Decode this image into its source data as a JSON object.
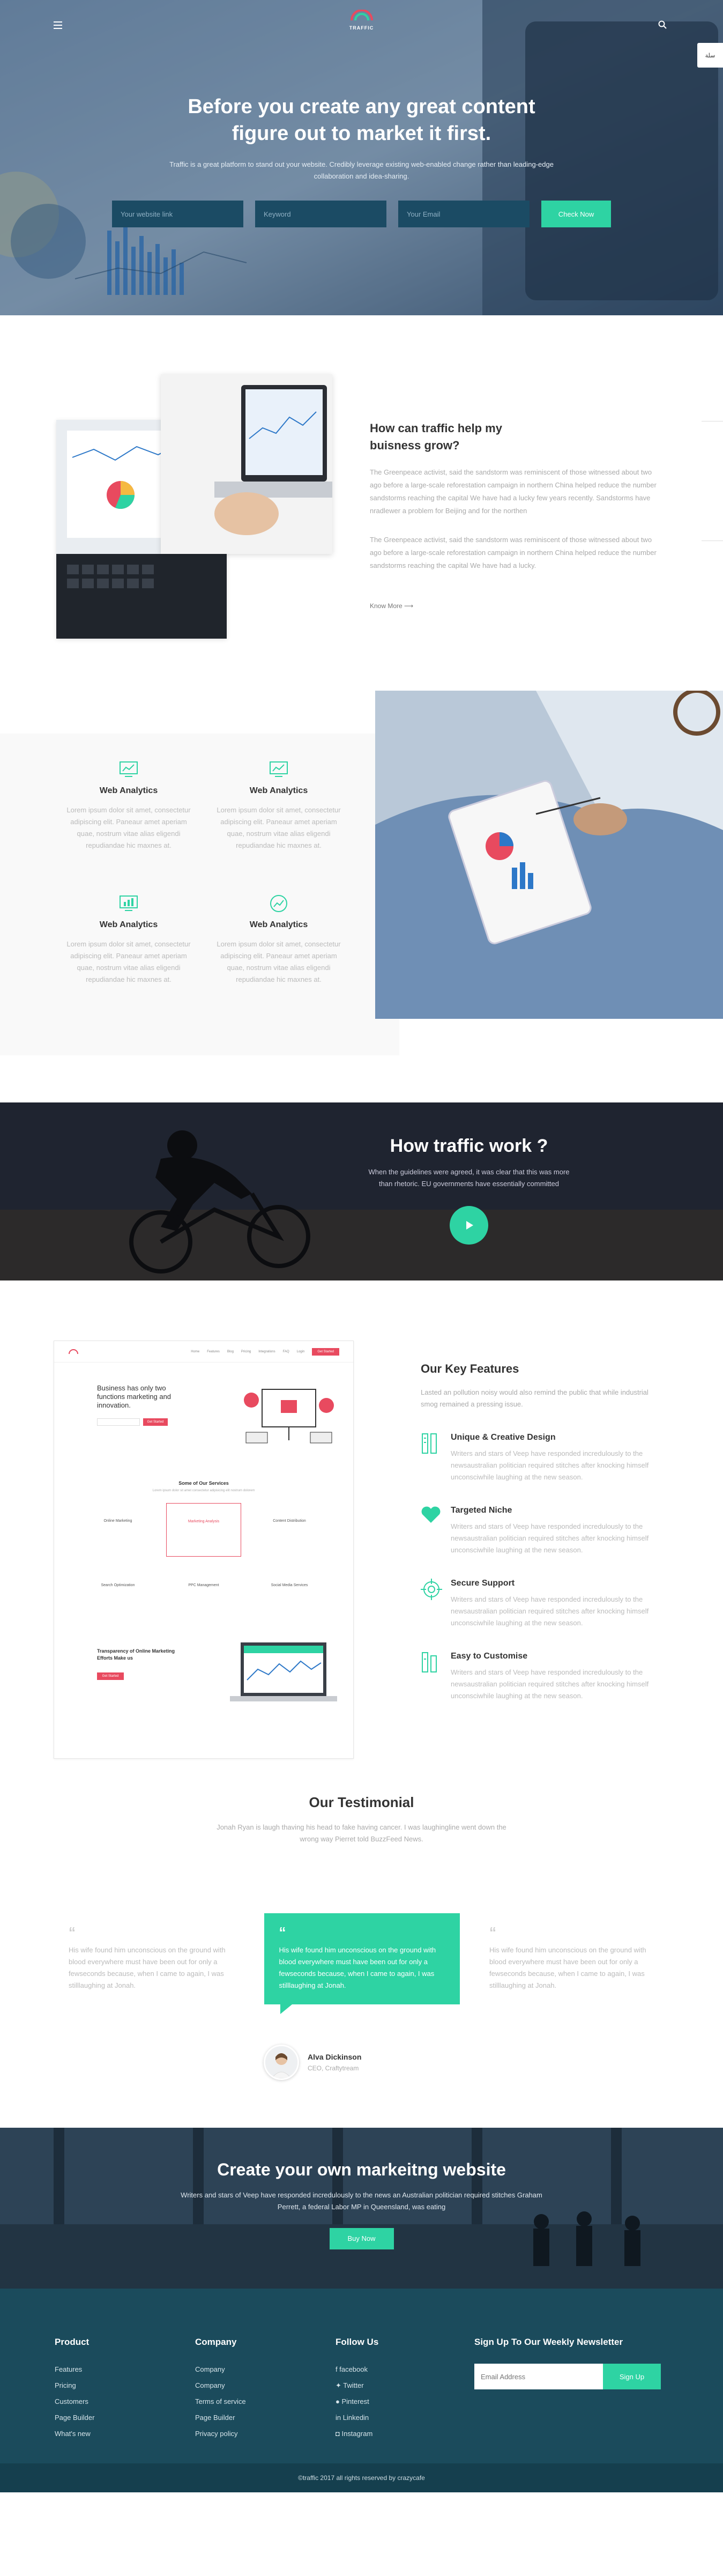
{
  "brand": {
    "logo_text": "TRAFFIC",
    "side_tab": "سلة"
  },
  "hero": {
    "title": "Before you create any great content figure out to market it first.",
    "subtitle": "Traffic is a great platform to stand out your website. Credibly leverage existing web-enabled change rather than leading-edge collaboration and idea-sharing.",
    "inputs": [
      {
        "placeholder": "Your website link"
      },
      {
        "placeholder": "Keyword"
      },
      {
        "placeholder": "Your Email"
      }
    ],
    "button": "Check Now"
  },
  "about": {
    "title": "How can traffic help my buisness grow?",
    "para1": "The Greenpeace activist, said the sandstorm was reminiscent of those witnessed about two ago before a large-scale reforestation campaign in northern China helped reduce the number sandstorms reaching the capital We have had a lucky few years recently. Sandstorms have nradlewer a problem for Beijing and for the northen",
    "para2": "The Greenpeace activist, said the sandstorm was reminiscent of those witnessed about two ago before a large-scale reforestation campaign in northern China helped reduce the number sandstorms reaching the capital We have had a lucky.",
    "link": "Know More ⟶"
  },
  "features": {
    "items": [
      {
        "title": "Web Analytics",
        "desc": "Lorem ipsum dolor sit amet, consectetur adipiscing elit. Paneaur amet aperiam quae, nostrum vitae alias eligendi repudiandae hic maxnes at."
      },
      {
        "title": "Web Analytics",
        "desc": "Lorem ipsum dolor sit amet, consectetur adipiscing elit. Paneaur amet aperiam quae, nostrum vitae alias eligendi repudiandae hic maxnes at."
      },
      {
        "title": "Web Analytics",
        "desc": "Lorem ipsum dolor sit amet, consectetur adipiscing elit. Paneaur amet aperiam quae, nostrum vitae alias eligendi repudiandae hic maxnes at."
      },
      {
        "title": "Web Analytics",
        "desc": "Lorem ipsum dolor sit amet, consectetur adipiscing elit. Paneaur amet aperiam quae, nostrum vitae alias eligendi repudiandae hic maxnes at."
      }
    ]
  },
  "how": {
    "title": "How traffic work ?",
    "text": "When the guidelines were agreed, it was clear that this was more than rhetoric. EU governments have essentially committed"
  },
  "mockup": {
    "nav": [
      "Home",
      "Features",
      "Blog",
      "Pricing",
      "Integrations",
      "FAQ",
      "Login"
    ],
    "nav_cta": "Get Started",
    "hero_title": "Business has only two functions marketing and innovation.",
    "hero_btn": "Get Started",
    "services_title": "Some of Our Services",
    "services_sub": "Lorem ipsum dolor sit amet consectetur adipisicing elit nostrum dolorem",
    "services": [
      "Online Marketing",
      "Marketing Analysis",
      "Content Distribution",
      "Search Optimization",
      "PPC Management",
      "Social Media Services"
    ],
    "bottom_title": "Transparency of Online Marketing Efforts Make us",
    "bottom_btn": "Get Started"
  },
  "key": {
    "title": "Our Key Features",
    "intro": "Lasted an pollution noisy would also remind the public that while industrial smog remained a pressing issue.",
    "items": [
      {
        "title": "Unique & Creative Design",
        "desc": "Writers and stars of Veep have responded incredulously to the newsaustralian politician required stitches after knocking himself unconsciwhile laughing at the new season."
      },
      {
        "title": "Targeted Niche",
        "desc": "Writers and stars of Veep have responded incredulously to the newsaustralian politician required stitches after knocking himself unconsciwhile laughing at the new season."
      },
      {
        "title": "Secure Support",
        "desc": "Writers and stars of Veep have responded incredulously to the newsaustralian politician required stitches after knocking himself unconsciwhile laughing at the new season."
      },
      {
        "title": "Easy to Customise",
        "desc": "Writers and stars of Veep have responded incredulously to the newsaustralian politician required stitches after knocking himself unconsciwhile laughing at the new season."
      }
    ]
  },
  "testimonial": {
    "title": "Our Testimonial",
    "subtitle": "Jonah Ryan is laugh thaving his head to fake having cancer. I was laughingline went down the wrong way Pierret told BuzzFeed News.",
    "cards": [
      {
        "quote": "“",
        "text": "His wife found him unconscious on the ground with blood everywhere must have been out for only a fewseconds because, when I came to again, I was stilllaughing at Jonah."
      },
      {
        "quote": "“",
        "text": "His wife found him unconscious on the ground with blood everywhere must have been out for only a fewseconds because, when I came to again, I was stilllaughing at Jonah."
      },
      {
        "quote": "“",
        "text": "His wife found him unconscious on the ground with blood everywhere must have been out for only a fewseconds because, when I came to again, I was stilllaughing at Jonah."
      }
    ],
    "author_name": "Alva Dickinson",
    "author_role": "CEO, Craftytream"
  },
  "cta": {
    "title": "Create your own markeitng website",
    "text": "Writers and stars of Veep have responded incredulously to the news an Australian politician required stitches Graham Perrett, a federal Labor MP in Queensland, was eating",
    "button": "Buy Now"
  },
  "footer": {
    "cols": [
      {
        "title": "Product",
        "links": [
          "Features",
          "Pricing",
          "Customers",
          "Page Builder",
          "What's new"
        ]
      },
      {
        "title": "Company",
        "links": [
          "Company",
          "Company",
          "Terms of service",
          "Page Builder",
          "Privacy policy"
        ]
      },
      {
        "title": "Follow Us",
        "links": [
          "facebook",
          "Twitter",
          "Pinterest",
          "Linkedin",
          "Instagram"
        ]
      }
    ],
    "news_title": "Sign Up To Our Weekly Newsletter",
    "news_placeholder": "Email Address",
    "news_btn": "Sign Up",
    "copyright": "©traffic 2017 all rights reserved by crazycafe"
  },
  "colors": {
    "accent": "#2ed3a3",
    "footer": "#1b4b5c",
    "hero_input": "#1b4b64"
  },
  "icons": [
    "menu-icon",
    "search-icon",
    "analytics-icon",
    "play-icon",
    "quote-icon",
    "facebook-icon",
    "twitter-icon",
    "pinterest-icon",
    "linkedin-icon",
    "instagram-icon"
  ]
}
